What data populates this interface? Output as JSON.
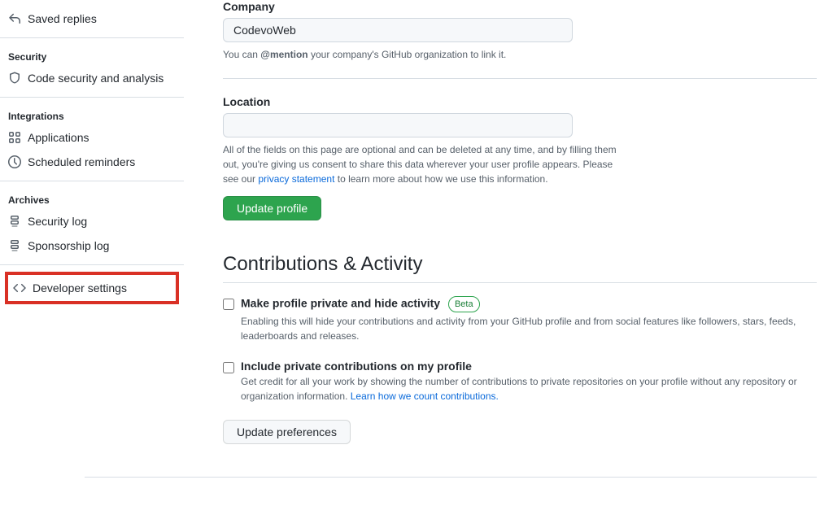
{
  "sidebar": {
    "saved_replies": "Saved replies",
    "security_header": "Security",
    "code_security": "Code security and analysis",
    "integrations_header": "Integrations",
    "applications": "Applications",
    "scheduled_reminders": "Scheduled reminders",
    "archives_header": "Archives",
    "security_log": "Security log",
    "sponsorship_log": "Sponsorship log",
    "developer_settings": "Developer settings"
  },
  "company": {
    "label": "Company",
    "value": "CodevoWeb",
    "note_prefix": "You can ",
    "note_mention": "@mention",
    "note_suffix": " your company's GitHub organization to link it."
  },
  "location": {
    "label": "Location",
    "value": "",
    "note_prefix": "All of the fields on this page are optional and can be deleted at any time, and by filling them out, you're giving us consent to share this data wherever your user profile appears. Please see our ",
    "note_link": "privacy statement",
    "note_suffix": " to learn more about how we use this information."
  },
  "update_profile_label": "Update profile",
  "contributions": {
    "title": "Contributions & Activity",
    "private_profile": {
      "label": "Make profile private and hide activity",
      "badge": "Beta",
      "desc": "Enabling this will hide your contributions and activity from your GitHub profile and from social features like followers, stars, feeds, leaderboards and releases."
    },
    "include_private": {
      "label": "Include private contributions on my profile",
      "desc_prefix": "Get credit for all your work by showing the number of contributions to private repositories on your profile without any repository or organization information. ",
      "desc_link": "Learn how we count contributions."
    },
    "update_prefs_label": "Update preferences"
  }
}
